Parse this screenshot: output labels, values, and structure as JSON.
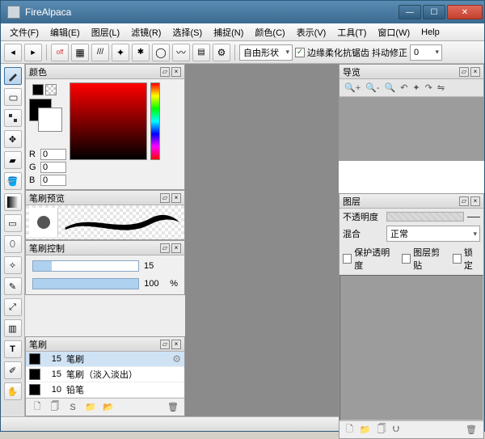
{
  "title": "FireAlpaca",
  "menus": [
    "文件(F)",
    "编辑(E)",
    "图层(L)",
    "滤镜(R)",
    "选择(S)",
    "捕捉(N)",
    "颜色(C)",
    "表示(V)",
    "工具(T)",
    "窗口(W)",
    "Help"
  ],
  "toolbar": {
    "off_label": "off",
    "shape_combo": "自由形状",
    "anti_alias_label": "边缘柔化抗锯齿",
    "jitter_label": "抖动修正",
    "jitter_value": "0"
  },
  "panels": {
    "color": {
      "title": "颜色",
      "r_label": "R",
      "r_value": "0",
      "g_label": "G",
      "g_value": "0",
      "b_label": "B",
      "b_value": "0"
    },
    "brush_preview": {
      "title": "笔刷预览"
    },
    "brush_control": {
      "title": "笔刷控制",
      "size_value": "15",
      "opacity_value": "100",
      "opacity_unit": "%"
    },
    "brush": {
      "title": "笔刷",
      "items": [
        {
          "size": "15",
          "name": "笔刷"
        },
        {
          "size": "15",
          "name": "笔刷（淡入淡出）"
        },
        {
          "size": "10",
          "name": "铅笔"
        }
      ]
    },
    "nav": {
      "title": "导览"
    },
    "layer": {
      "title": "图层",
      "opacity_label": "不透明度",
      "blend_label": "混合",
      "blend_value": "正常",
      "protect_alpha": "保护透明度",
      "clip_layer": "图层剪贴",
      "lock": "锁定"
    }
  }
}
